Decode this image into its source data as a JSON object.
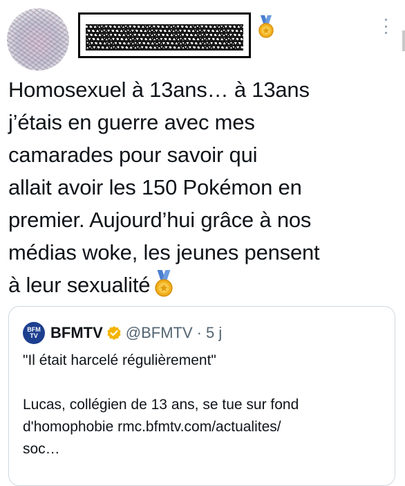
{
  "author": {
    "avatar_icon": "blurred-avatar",
    "name_redacted": true,
    "badge_icon": "medal-icon"
  },
  "tweet": {
    "lines": [
      "Homosexuel à 13ans… à 13ans",
      "j’étais en guerre avec mes",
      "camarades pour savoir qui",
      "allait avoir les 150 Pokémon en",
      "premier. Aujourd’hui grâce à nos",
      "médias woke, les jeunes pensent",
      "à leur sexualité"
    ],
    "trailing_emoji": "medal-icon"
  },
  "quote": {
    "logo_text": "BFM TV",
    "name": "BFMTV",
    "handle": "@BFMTV",
    "separator": "·",
    "time": "5 j",
    "verified_color": "#f4b400",
    "body_line1": "\"Il était harcelé régulièrement\"",
    "body_lines": [
      "Lucas, collégien de 13 ans, se tue sur fond",
      "d'homophobie rmc.bfmtv.com/actualites/",
      "soc…"
    ]
  },
  "colors": {
    "text": "#0f1419",
    "secondary": "#536471",
    "border": "#cfd9de",
    "bfm_blue": "#1d3f8f"
  }
}
